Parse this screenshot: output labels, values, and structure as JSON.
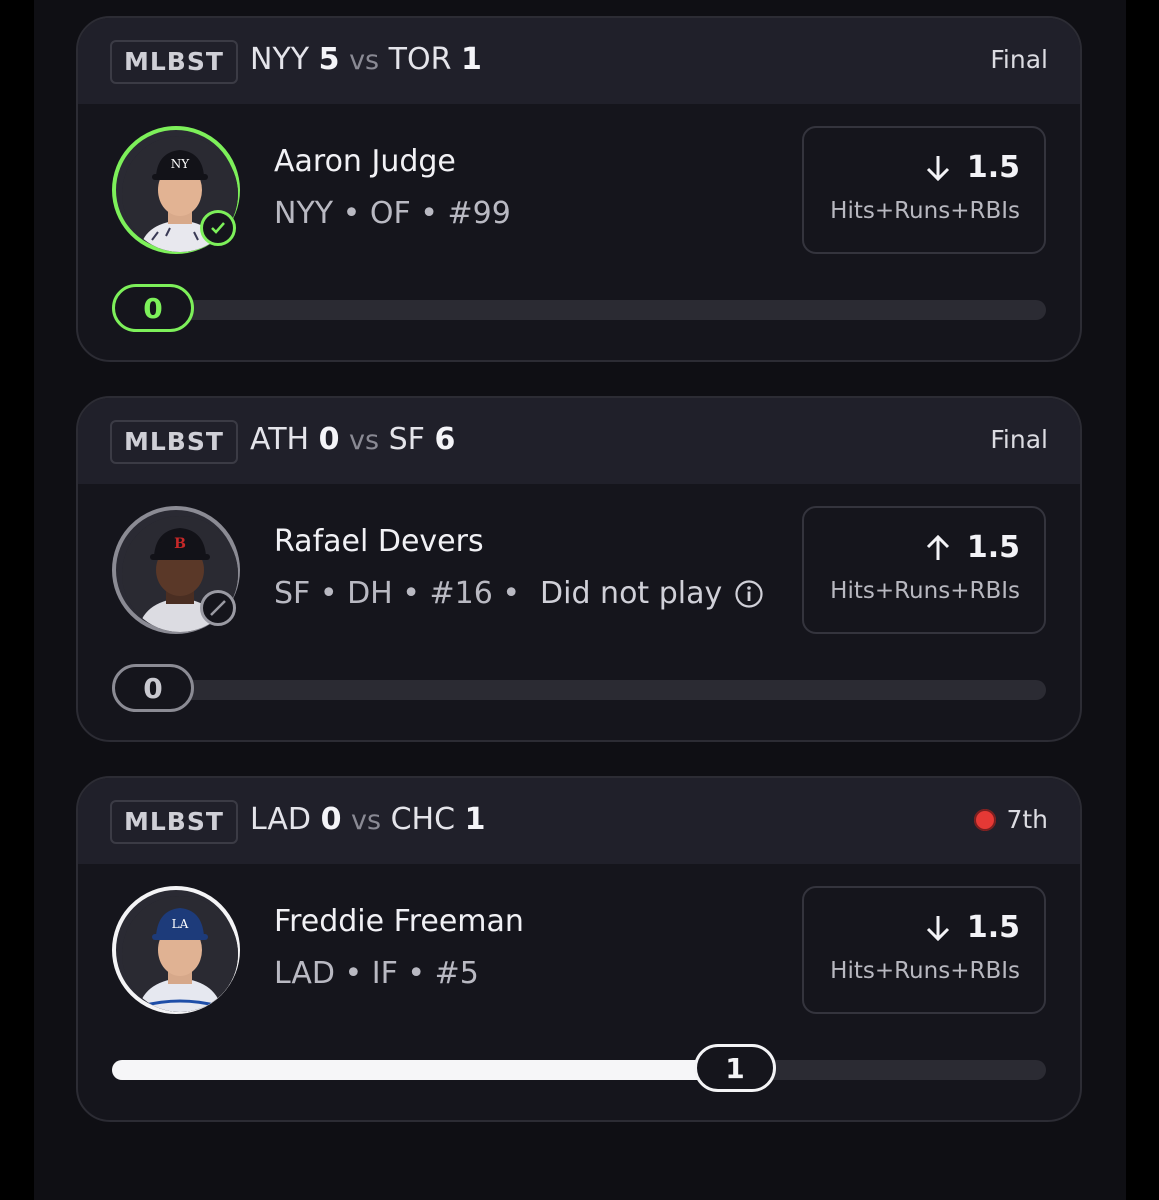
{
  "colors": {
    "background": "#000000",
    "card": "#15151c",
    "card_header": "#20202a",
    "accent_green": "#7df05a",
    "live_red": "#e53935"
  },
  "cards": [
    {
      "league": "MLBST",
      "home_team": "NYY",
      "home_score": "5",
      "vs": "vs",
      "away_team": "TOR",
      "away_score": "1",
      "status": "Final",
      "live": false,
      "player_name": "Aaron Judge",
      "player_meta": "NYY • OF • #99",
      "player_status_note": "",
      "avatar_badge": "check-icon",
      "pick_direction": "down-arrow-icon",
      "line": "1.5",
      "category": "Hits+Runs+RBIs",
      "current_value": "0",
      "progress_fraction": 0
    },
    {
      "league": "MLBST",
      "home_team": "ATH",
      "home_score": "0",
      "vs": "vs",
      "away_team": "SF",
      "away_score": "6",
      "status": "Final",
      "live": false,
      "player_name": "Rafael Devers",
      "player_meta": "SF • DH • #16 •",
      "player_status_note": "Did not play",
      "avatar_badge": "no-entry-icon",
      "pick_direction": "up-arrow-icon",
      "line": "1.5",
      "category": "Hits+Runs+RBIs",
      "current_value": "0",
      "progress_fraction": 0
    },
    {
      "league": "MLBST",
      "home_team": "LAD",
      "home_score": "0",
      "vs": "vs",
      "away_team": "CHC",
      "away_score": "1",
      "status": "7th",
      "live": true,
      "player_name": "Freddie Freeman",
      "player_meta": "LAD • IF • #5",
      "player_status_note": "",
      "avatar_badge": "",
      "pick_direction": "down-arrow-icon",
      "line": "1.5",
      "category": "Hits+Runs+RBIs",
      "current_value": "1",
      "progress_fraction": 0.667
    }
  ]
}
